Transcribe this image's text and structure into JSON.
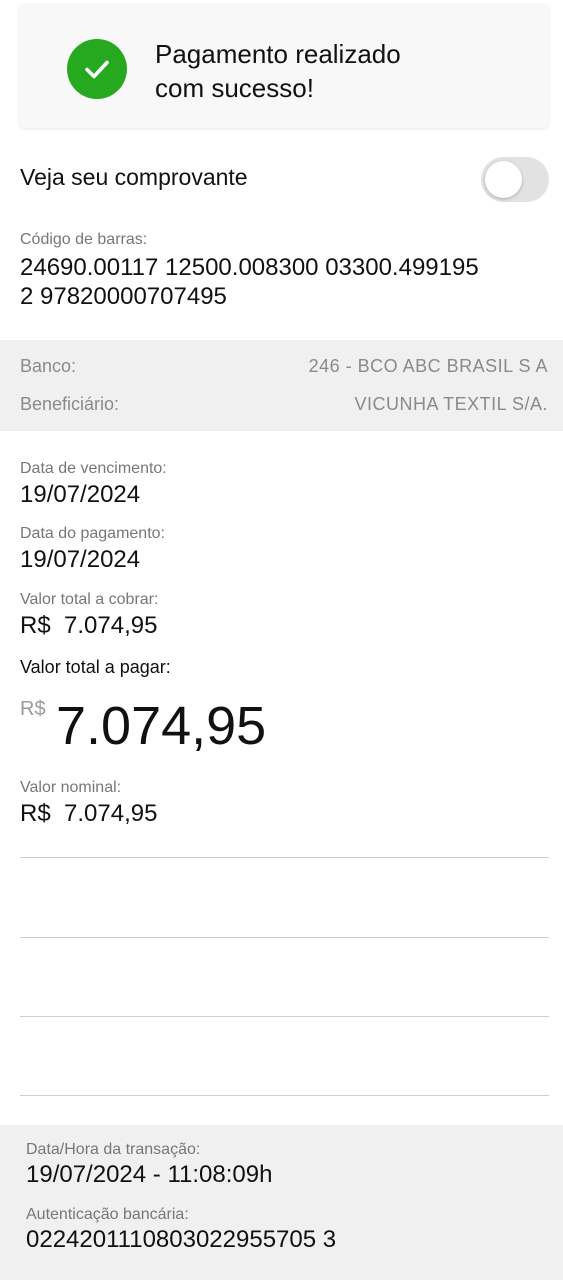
{
  "success": {
    "line1": "Pagamento realizado",
    "line2": "com sucesso!"
  },
  "receipt_toggle": {
    "label": "Veja seu comprovante",
    "state": "off"
  },
  "barcode": {
    "label": "Código de barras:",
    "line1": "24690.00117 12500.008300 03300.499195",
    "line2": "2 97820000707495"
  },
  "info": {
    "bank_label": "Banco:",
    "bank_value": "246 - BCO ABC BRASIL S A",
    "beneficiary_label": "Beneficiário:",
    "beneficiary_value": "VICUNHA TEXTIL S/A."
  },
  "due_date": {
    "label": "Data de vencimento:",
    "value": "19/07/2024"
  },
  "payment_date": {
    "label": "Data do pagamento:",
    "value": "19/07/2024"
  },
  "total_charge": {
    "label": "Valor total a cobrar:",
    "value": "R$  7.074,95"
  },
  "total_pay": {
    "label": "Valor total a pagar:",
    "currency": "R$",
    "amount": "7.074,95"
  },
  "nominal": {
    "label": "Valor nominal:",
    "value": "R$  7.074,95"
  },
  "transaction": {
    "datetime_label": "Data/Hora da transação:",
    "datetime_value": "19/07/2024 - 11:08:09h",
    "auth_label": "Autenticação bancária:",
    "auth_value": "0224201110803022955705 3"
  },
  "colors": {
    "success_green": "#26a81f",
    "band_gray": "#f0f0f0",
    "muted_text": "#8a8a8a"
  }
}
